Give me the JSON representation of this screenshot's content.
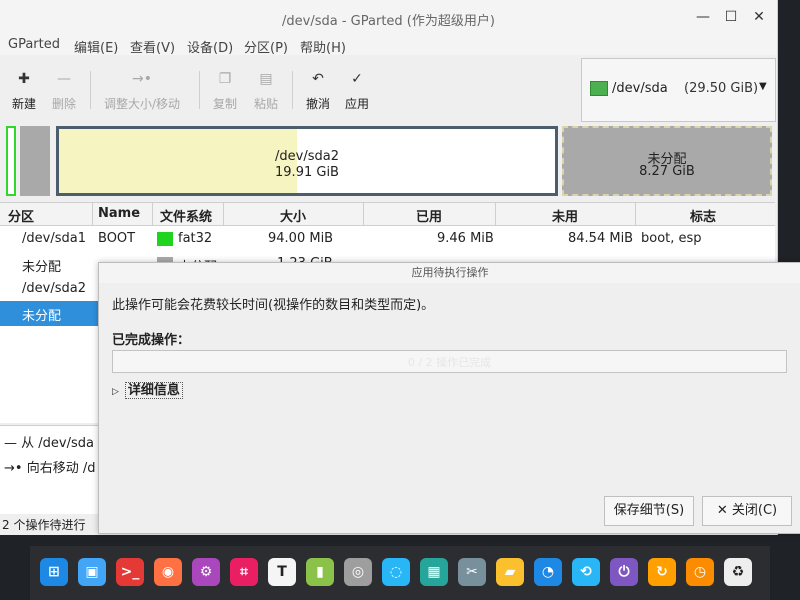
{
  "window": {
    "title": "/dev/sda - GParted (作为超级用户)",
    "controls": {
      "minimize": "—",
      "maximize": "☐",
      "close": "✕"
    }
  },
  "menu": {
    "items": [
      "GParted",
      "编辑(E)",
      "查看(V)",
      "设备(D)",
      "分区(P)",
      "帮助(H)"
    ]
  },
  "toolbar": {
    "new": {
      "label": "新建",
      "icon": "new-icon",
      "glyph": "✚"
    },
    "delete": {
      "label": "删除",
      "icon": "delete-icon",
      "glyph": "—"
    },
    "resize": {
      "label": "调整大小/移动",
      "icon": "resize-icon",
      "glyph": "→•"
    },
    "copy": {
      "label": "复制",
      "icon": "copy-icon",
      "glyph": "❐"
    },
    "paste": {
      "label": "粘贴",
      "icon": "paste-icon",
      "glyph": "▤"
    },
    "undo": {
      "label": "撤消",
      "icon": "undo-icon",
      "glyph": "↶"
    },
    "apply": {
      "label": "应用",
      "icon": "check-icon",
      "glyph": "✓"
    }
  },
  "device_selector": {
    "device": "/dev/sda",
    "size": "(29.50 GiB)",
    "arrow": "▼"
  },
  "partition_map": {
    "sda2": {
      "name": "/dev/sda2",
      "size": "19.91 GiB"
    },
    "unallocated": {
      "name": "未分配",
      "size": "8.27 GiB"
    }
  },
  "table": {
    "headers": [
      "分区",
      "Name",
      "文件系统",
      "大小",
      "已用",
      "未用",
      "标志"
    ],
    "rows": [
      {
        "partition": "/dev/sda1",
        "name": "BOOT",
        "filesystem": "fat32",
        "fs_color": "#1fd31f",
        "size": "94.00 MiB",
        "used": "9.46 MiB",
        "unused": "84.54 MiB",
        "flags": "boot, esp"
      },
      {
        "partition": "未分配",
        "name": "",
        "filesystem": "未分配",
        "fs_color": "#a9a9a9",
        "size": "1.23 GiB",
        "used": "",
        "unused": "",
        "flags": ""
      },
      {
        "partition": "/dev/sda2"
      },
      {
        "partition": "未分配"
      }
    ],
    "selected_row": 3
  },
  "pending_ops": {
    "items": [
      {
        "icon": "remove-icon",
        "glyph": "—",
        "text": "从 /dev/sda"
      },
      {
        "icon": "move-right-icon",
        "glyph": "→•",
        "text": "向右移动 /d"
      }
    ],
    "status": "2 个操作待进行"
  },
  "dialog": {
    "title": "应用待执行操作",
    "message": "此操作可能会花费较长时间(视操作的数目和类型而定)。",
    "completed_label": "已完成操作：",
    "progress_text": "0 / 2 操作已完成",
    "progress": 0.0,
    "details_label": "详细信息",
    "save_label": "保存细节(S)",
    "close_label": "关闭(C)",
    "close_glyph": "✕"
  },
  "dock": {
    "apps": [
      {
        "name": "launcher-icon",
        "glyph": "⊞",
        "color": "#1e88e5"
      },
      {
        "name": "app-store-icon",
        "glyph": "▣",
        "color": "#42a5f5"
      },
      {
        "name": "terminal-icon",
        "glyph": ">_",
        "color": "#e53935"
      },
      {
        "name": "firefox-icon",
        "glyph": "◉",
        "color": "#ff7043"
      },
      {
        "name": "settings-icon",
        "glyph": "⚙",
        "color": "#ab47bc"
      },
      {
        "name": "screenshot-icon",
        "glyph": "⌗",
        "color": "#e91e63"
      },
      {
        "name": "text-editor-icon",
        "glyph": "T",
        "color": "#f5f5f5"
      },
      {
        "name": "archive-icon",
        "glyph": "▮",
        "color": "#8bc34a"
      },
      {
        "name": "disk-utility-icon",
        "glyph": "◎",
        "color": "#9e9e9e"
      },
      {
        "name": "deepin-icon",
        "glyph": "◌",
        "color": "#29b6f6"
      },
      {
        "name": "monitor-icon",
        "glyph": "▦",
        "color": "#26a69a"
      },
      {
        "name": "tools-icon",
        "glyph": "✂",
        "color": "#78909c"
      },
      {
        "name": "usb-icon",
        "glyph": "▰",
        "color": "#fbc02d"
      },
      {
        "name": "sync-icon",
        "glyph": "◔",
        "color": "#1e88e5"
      },
      {
        "name": "capture-icon",
        "glyph": "⟲",
        "color": "#29b6f6"
      },
      {
        "name": "power-icon",
        "glyph": "⏻",
        "color": "#7e57c2"
      },
      {
        "name": "backup-icon",
        "glyph": "↻",
        "color": "#ffa000"
      },
      {
        "name": "clock-icon",
        "glyph": "◷",
        "color": "#fb8c00"
      },
      {
        "name": "trash-icon",
        "glyph": "♻",
        "color": "#eeeeee"
      }
    ]
  }
}
